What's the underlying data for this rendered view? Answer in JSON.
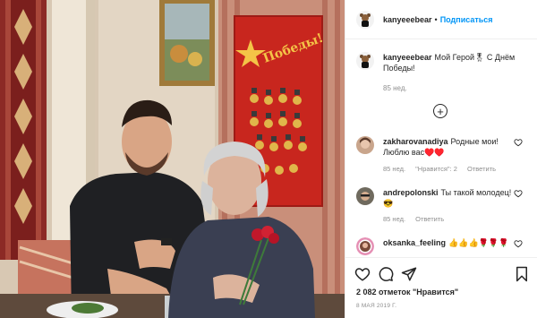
{
  "post": {
    "username": "kanyeeebear",
    "follow_label": "Подписаться",
    "separator": "•",
    "caption_text": "Мой Герой🎖 С Днём Победы!",
    "caption_time": "85 нед.",
    "load_more_icon": "plus-circle-icon",
    "poster_text": "Победы!"
  },
  "comments": [
    {
      "username": "zakharovanadiya",
      "text": "Родные мои! Люблю вас♥️♥️",
      "time": "85 нед.",
      "likes": "\"Нравится\": 2",
      "reply": "Ответить"
    },
    {
      "username": "andrepolonski",
      "text": "Ты такой молодец!😎",
      "time": "85 нед.",
      "reply": "Ответить"
    },
    {
      "username": "oksanka_feeling",
      "text": "👍👍👍🌹🌹🌹"
    }
  ],
  "actions": {
    "like_icon": "heart-icon",
    "comment_icon": "comment-icon",
    "share_icon": "paper-plane-icon",
    "save_icon": "bookmark-icon",
    "likes_text": "2 082 отметок \"Нравится\"",
    "date_text": "8 МАЯ 2019 Г."
  },
  "colors": {
    "accent": "#0095f6",
    "muted": "#8e8e8e",
    "poster_red": "#c8261e",
    "heart_red": "#c0182b"
  }
}
